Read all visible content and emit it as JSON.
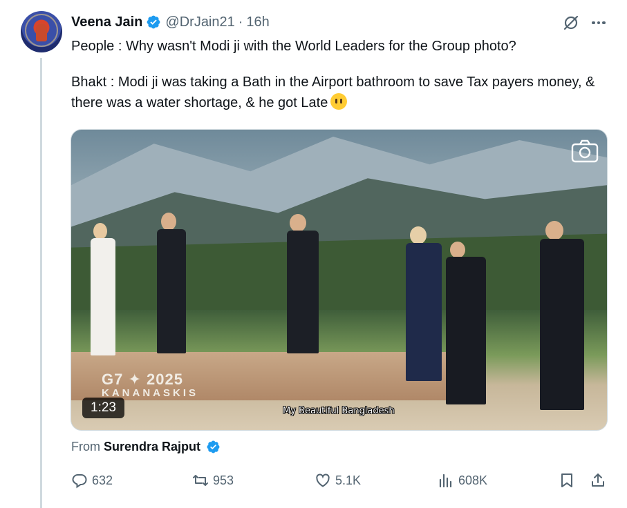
{
  "author": {
    "display_name": "Veena Jain",
    "handle": "@DrJain21",
    "separator": "·",
    "time": "16h",
    "verified": true
  },
  "tweet": {
    "line1": "People : Why wasn't Modi ji with the World Leaders for the Group photo?",
    "line2": "Bhakt : Modi ji was taking a Bath in the Airport bathroom to save Tax payers money, & there was a water shortage, & he got Late",
    "emoji": "neutral-face-emoji"
  },
  "media": {
    "duration": "1:23",
    "stage_text_line1": "G7 ✦ 2025",
    "stage_text_line2": "KANANASKIS",
    "caption": "My Beautiful Bangladesh"
  },
  "source": {
    "prefix": "From",
    "author": "Surendra Rajput",
    "verified": true
  },
  "actions": {
    "reply_count": "632",
    "retweet_count": "953",
    "like_count": "5.1K",
    "views_count": "608K"
  },
  "colors": {
    "text": "#0f1419",
    "secondary": "#536471",
    "verified_blue": "#1d9bf0",
    "thread_line": "#cfd9de"
  }
}
